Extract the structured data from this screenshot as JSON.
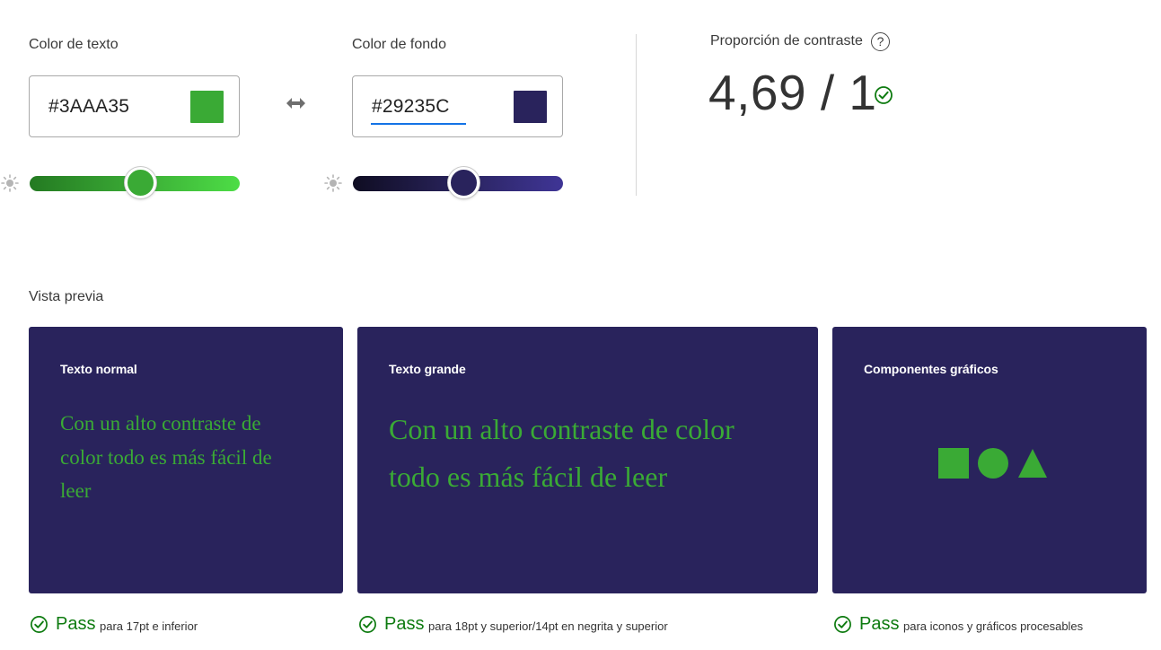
{
  "colors": {
    "text": "#3AAA35",
    "background": "#29235C",
    "pass_green": "#0E7B10",
    "focus_blue": "#1473E6"
  },
  "text_color": {
    "label": "Color de texto",
    "value": "#3AAA35",
    "slider_icon": "sun-icon"
  },
  "swap": {
    "icon": "swap-arrows-icon"
  },
  "background_color": {
    "label": "Color de fondo",
    "value": "#29235C",
    "slider_icon": "sun-icon"
  },
  "contrast": {
    "label": "Proporción de contraste",
    "help": "?",
    "value": "4,69 / 1",
    "status_icon": "check-circle-icon"
  },
  "preview": {
    "title": "Vista previa",
    "cards": [
      {
        "title": "Texto normal",
        "sample": "Con un alto contraste de color todo es más fácil de leer"
      },
      {
        "title": "Texto grande",
        "sample": "Con un alto contraste de color todo es más fácil de leer"
      },
      {
        "title": "Componentes gráficos",
        "shapes": [
          "square",
          "circle",
          "triangle"
        ]
      }
    ]
  },
  "results": [
    {
      "status": "Pass",
      "description": "para 17pt e inferior"
    },
    {
      "status": "Pass",
      "description": "para 18pt y superior/14pt en negrita y superior"
    },
    {
      "status": "Pass",
      "description": "para iconos y gráficos procesables"
    }
  ]
}
